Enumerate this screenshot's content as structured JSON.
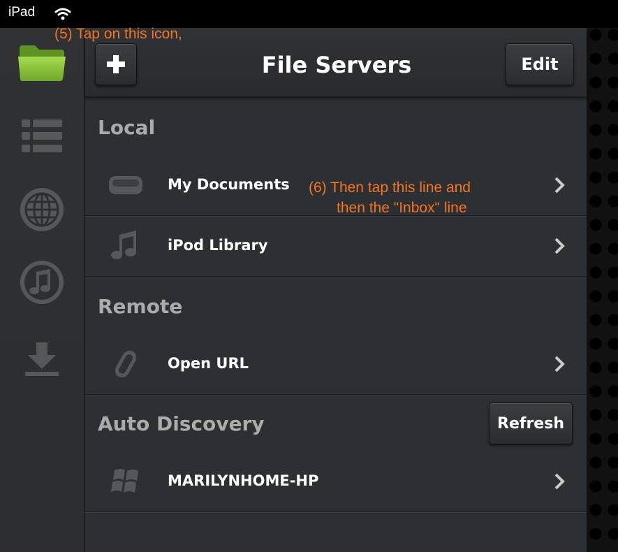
{
  "status_bar": {
    "device": "iPad",
    "wifi_icon": "wifi-icon"
  },
  "sidebar": {
    "items": [
      {
        "name": "folder-icon",
        "active": true,
        "color": "#8dc53e"
      },
      {
        "name": "list-icon",
        "active": false
      },
      {
        "name": "globe-icon",
        "active": false
      },
      {
        "name": "music-note-icon",
        "active": false
      },
      {
        "name": "download-icon",
        "active": false
      }
    ]
  },
  "navbar": {
    "title": "File Servers",
    "add_label": "+",
    "edit_label": "Edit"
  },
  "sections": {
    "local": {
      "header": "Local",
      "items": [
        {
          "label": "My Documents",
          "icon": "hard-drive-icon"
        },
        {
          "label": "iPod Library",
          "icon": "music-note-icon"
        }
      ]
    },
    "remote": {
      "header": "Remote",
      "items": [
        {
          "label": "Open URL",
          "icon": "link-icon"
        }
      ]
    },
    "auto_discovery": {
      "header": "Auto Discovery",
      "refresh_label": "Refresh",
      "items": [
        {
          "label": "MARILYNHOME-HP",
          "icon": "windows-icon"
        }
      ]
    }
  },
  "annotations": {
    "step5": "(5) Tap on this icon,",
    "step6_line1": "(6) Then tap this line and",
    "step6_line2": "then the \"Inbox\" line"
  },
  "colors": {
    "accent": "#8dc53e",
    "annotation": "#f47521"
  }
}
